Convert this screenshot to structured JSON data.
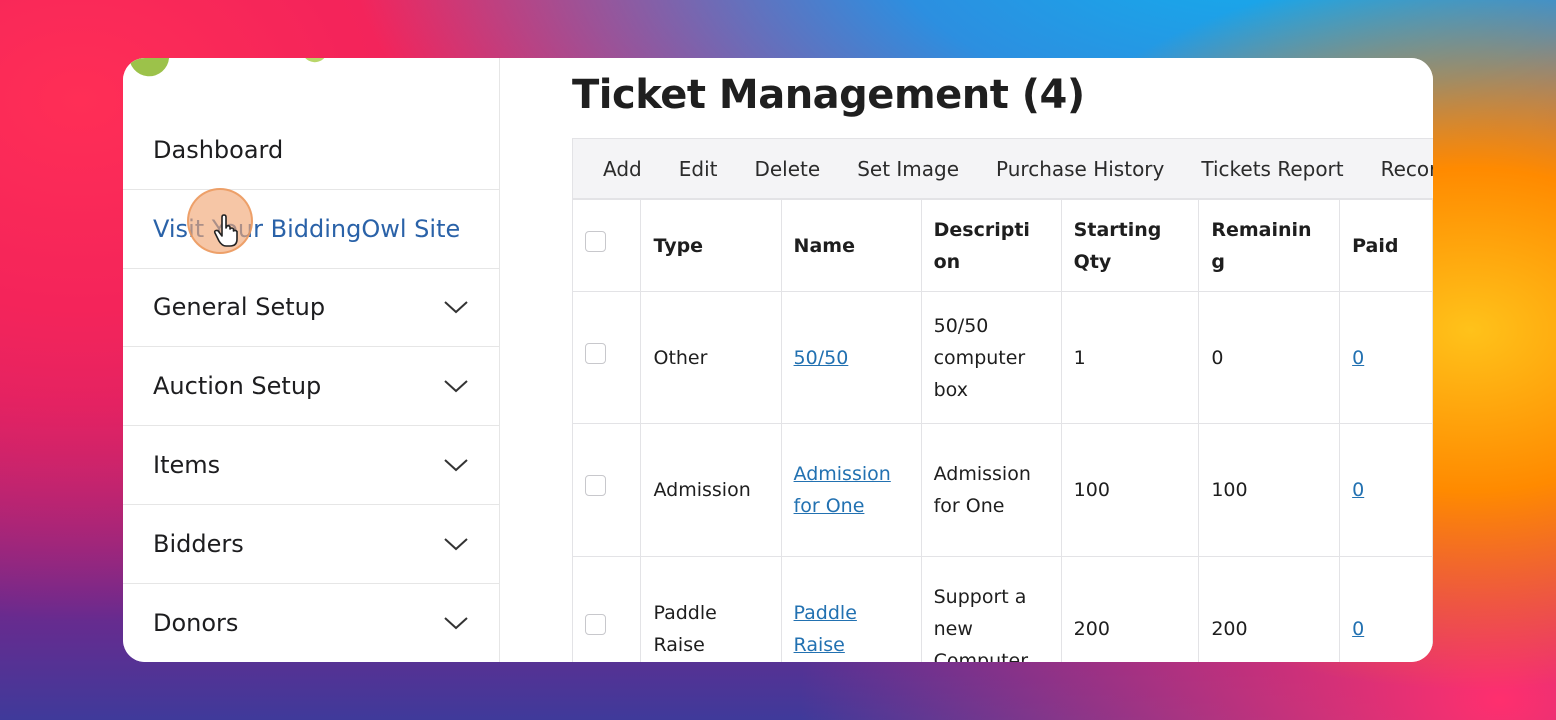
{
  "sidebar": {
    "items": [
      {
        "label": "Dashboard",
        "expandable": false
      },
      {
        "label": "Visit Your BiddingOwl Site",
        "expandable": false,
        "link": true
      },
      {
        "label": "General Setup",
        "expandable": true
      },
      {
        "label": "Auction Setup",
        "expandable": true
      },
      {
        "label": "Items",
        "expandable": true
      },
      {
        "label": "Bidders",
        "expandable": true
      },
      {
        "label": "Donors",
        "expandable": true
      }
    ]
  },
  "main": {
    "title": "Ticket Management (4)",
    "toolbar": [
      "Add",
      "Edit",
      "Delete",
      "Set Image",
      "Purchase History",
      "Tickets Report",
      "Record"
    ],
    "table": {
      "headers": [
        "Type",
        "Name",
        "Descripti on",
        "Starting Qty",
        "Remainin g",
        "Paid"
      ],
      "rows": [
        {
          "type": "Other",
          "name": "50/50",
          "description": "50/50 computer box",
          "starting_qty": "1",
          "remaining": "0",
          "paid": "0"
        },
        {
          "type": "Admission",
          "name": "Admission for One",
          "description": "Admission for One",
          "starting_qty": "100",
          "remaining": "100",
          "paid": "0"
        },
        {
          "type": "Paddle Raise",
          "name": "Paddle Raise",
          "description": "Support a new Computer",
          "starting_qty": "200",
          "remaining": "200",
          "paid": "0"
        }
      ]
    }
  },
  "colors": {
    "link": "#2271b1",
    "sidebar_link": "#2a62a8",
    "toolbar_bg": "#f4f4f6"
  }
}
